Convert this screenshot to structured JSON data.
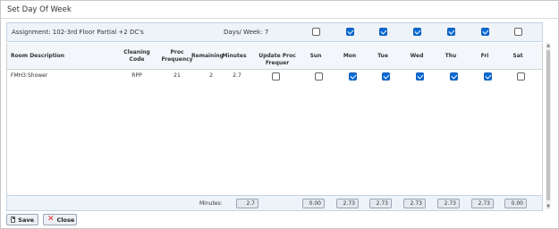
{
  "dialog": {
    "title": "Set Day Of Week"
  },
  "assignment": {
    "label": "Assignment: 102-3rd Floor Partial +2 DC's",
    "days_label": "Days/ Week: 7",
    "day_checks": [
      false,
      true,
      true,
      true,
      true,
      true,
      false
    ]
  },
  "grid": {
    "headers": {
      "room": "Room Description",
      "cleaning": "Cleaning Code",
      "proc_freq": "Proc Frequency",
      "remaining": "Remaining",
      "minutes": "Minutes",
      "update": "Update Proc Frequer",
      "sun": "Sun",
      "mon": "Mon",
      "tue": "Tue",
      "wed": "Wed",
      "thu": "Thu",
      "fri": "Fri",
      "sat": "Sat"
    },
    "rows": [
      {
        "room": "FMH3:Shower",
        "cleaning": "RPP",
        "proc_freq": "21",
        "remaining": "2",
        "minutes": "2.7",
        "update": false,
        "days": [
          false,
          true,
          true,
          true,
          true,
          true,
          false
        ]
      }
    ]
  },
  "footer": {
    "label": "Minutes:",
    "total": "2.7",
    "day_totals": [
      "0.00",
      "2.73",
      "2.73",
      "2.73",
      "2.73",
      "2.73",
      "0.00"
    ]
  },
  "buttons": {
    "save": "Save",
    "close": "Close"
  }
}
